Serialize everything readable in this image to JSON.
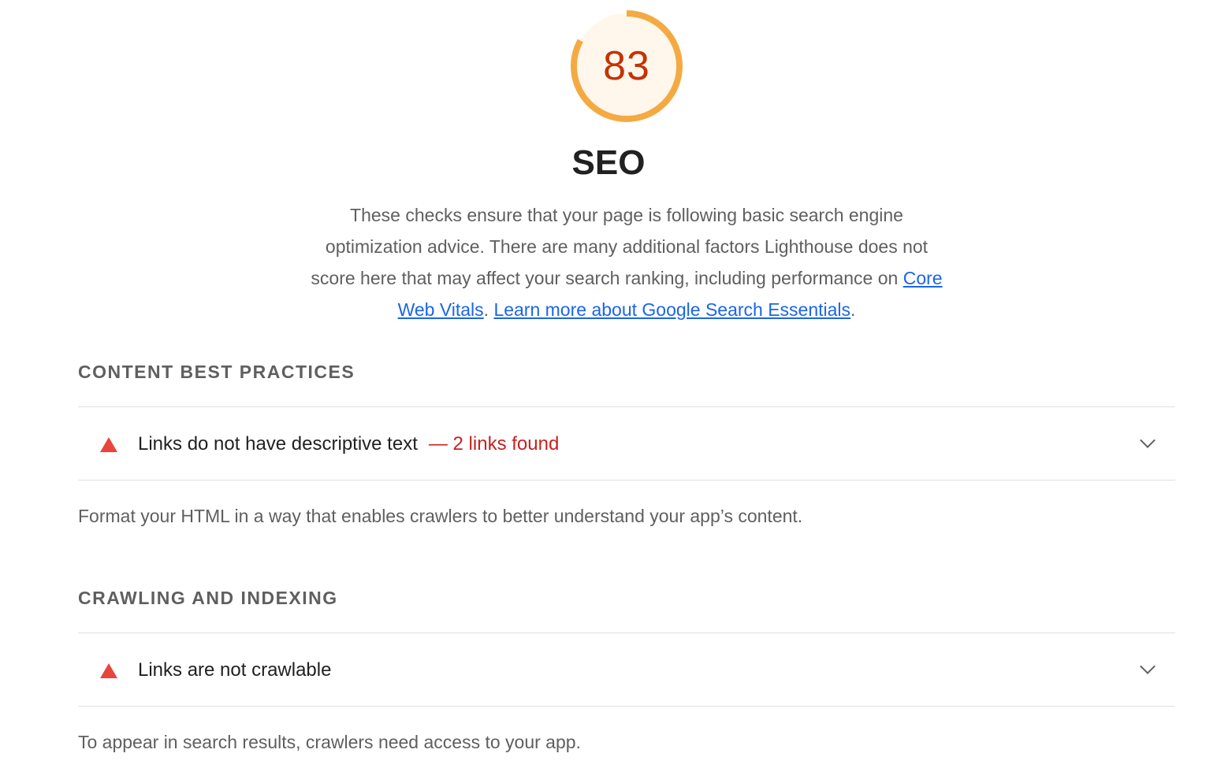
{
  "score": {
    "value": "83",
    "fraction": 0.83,
    "ring_color": "#f4aa42",
    "fill_color": "#fff6ec",
    "text_color": "#c33300"
  },
  "category": {
    "title": "SEO",
    "description_text": "These checks ensure that your page is following basic search engine optimization advice. There are many additional factors Lighthouse does not score here that may affect your search ranking, including performance on",
    "link_cwv": "Core Web Vitals",
    "sep": ".",
    "link_learn": "Learn more about Google Search Essentials",
    "end": "."
  },
  "groups": [
    {
      "title": "CONTENT BEST PRACTICES",
      "audit": {
        "title": "Links do not have descriptive text",
        "value": "— 2 links found",
        "status_icon": "warning-triangle-icon",
        "status_color": "#e8453c"
      },
      "description": "Format your HTML in a way that enables crawlers to better understand your app’s content."
    },
    {
      "title": "CRAWLING AND INDEXING",
      "audit": {
        "title": "Links are not crawlable",
        "status_icon": "warning-triangle-icon",
        "status_color": "#e8453c"
      },
      "description": "To appear in search results, crawlers need access to your app."
    }
  ]
}
